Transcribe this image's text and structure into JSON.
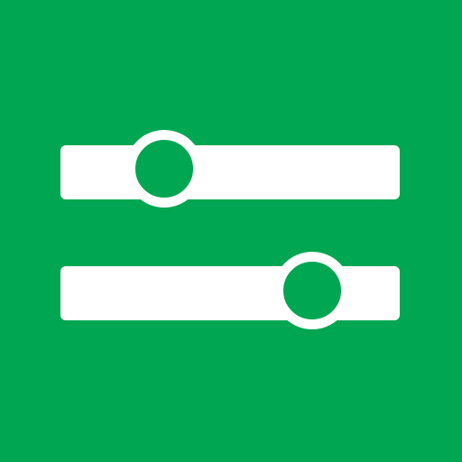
{
  "icon": {
    "name": "sliders-icon",
    "background_color": "#00a651",
    "foreground_color": "#ffffff",
    "sliders": [
      {
        "name": "slider-top",
        "value": 0.31
      },
      {
        "name": "slider-bottom",
        "value": 0.74
      }
    ]
  }
}
